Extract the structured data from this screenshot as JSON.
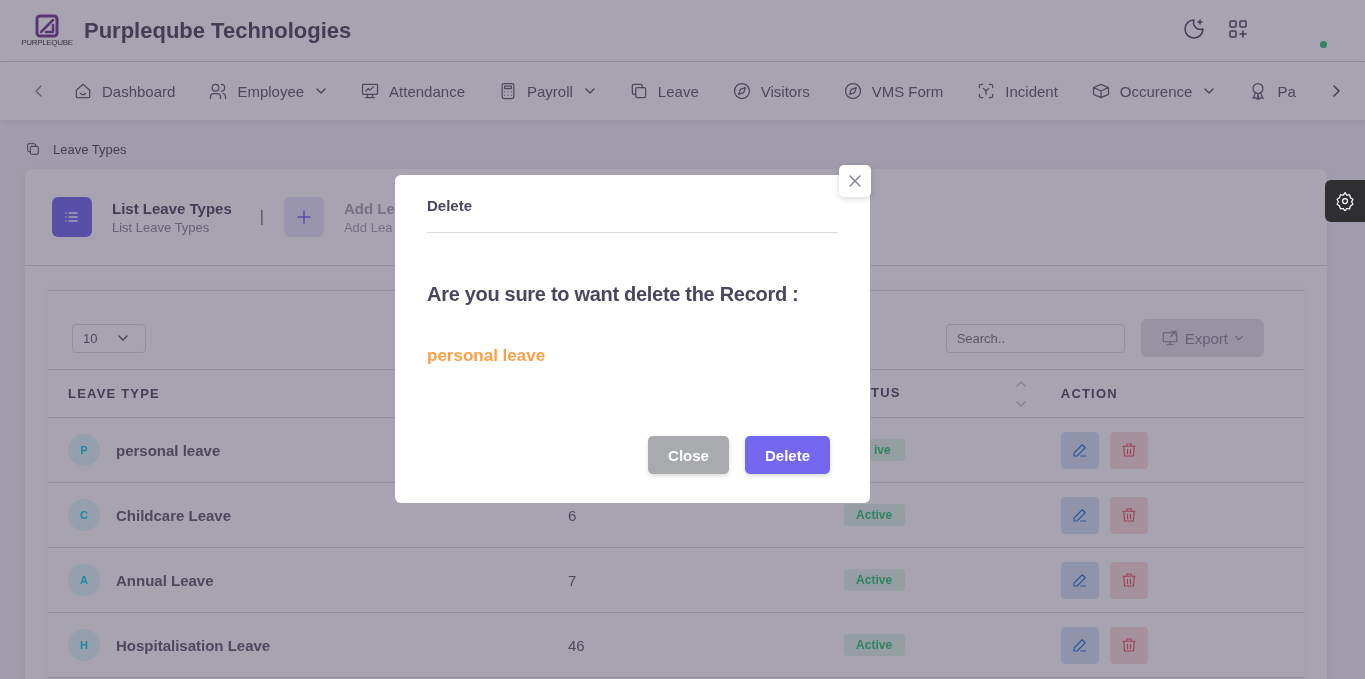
{
  "header": {
    "company": "Purpleqube Technologies",
    "logo_text": "PURPLEQUBE",
    "online": true
  },
  "nav": [
    {
      "label": "Dashboard",
      "has_menu": false
    },
    {
      "label": "Employee",
      "has_menu": true
    },
    {
      "label": "Attendance",
      "has_menu": false
    },
    {
      "label": "Payroll",
      "has_menu": true
    },
    {
      "label": "Leave",
      "has_menu": false
    },
    {
      "label": "Visitors",
      "has_menu": false
    },
    {
      "label": "VMS Form",
      "has_menu": false
    },
    {
      "label": "Incident",
      "has_menu": false
    },
    {
      "label": "Occurence",
      "has_menu": true
    },
    {
      "label": "Pa",
      "has_menu": false
    }
  ],
  "breadcrumb": "Leave Types",
  "steps": [
    {
      "title": "List Leave Types",
      "subtitle": "List Leave Types",
      "selected": true
    },
    {
      "title": "Add Le",
      "subtitle": "Add Lea",
      "selected": false
    }
  ],
  "step_separator": "|",
  "page_size": "10",
  "search": {
    "placeholder": "Search.."
  },
  "export_label": "Export",
  "table": {
    "columns": [
      "LEAVE TYPE",
      "TUS",
      "ACTION"
    ],
    "rows": [
      {
        "initial": "P",
        "name": "personal leave",
        "status": "ive"
      },
      {
        "initial": "C",
        "name": "Childcare Leave",
        "days": "6",
        "status": "Active"
      },
      {
        "initial": "A",
        "name": "Annual Leave",
        "days": "7",
        "status": "Active"
      },
      {
        "initial": "H",
        "name": "Hospitalisation Leave",
        "days": "46",
        "status": "Active"
      }
    ]
  },
  "modal": {
    "title": "Delete",
    "question": "Are you sure to want delete the Record :",
    "record": "personal leave",
    "close_label": "Close",
    "delete_label": "Delete"
  }
}
